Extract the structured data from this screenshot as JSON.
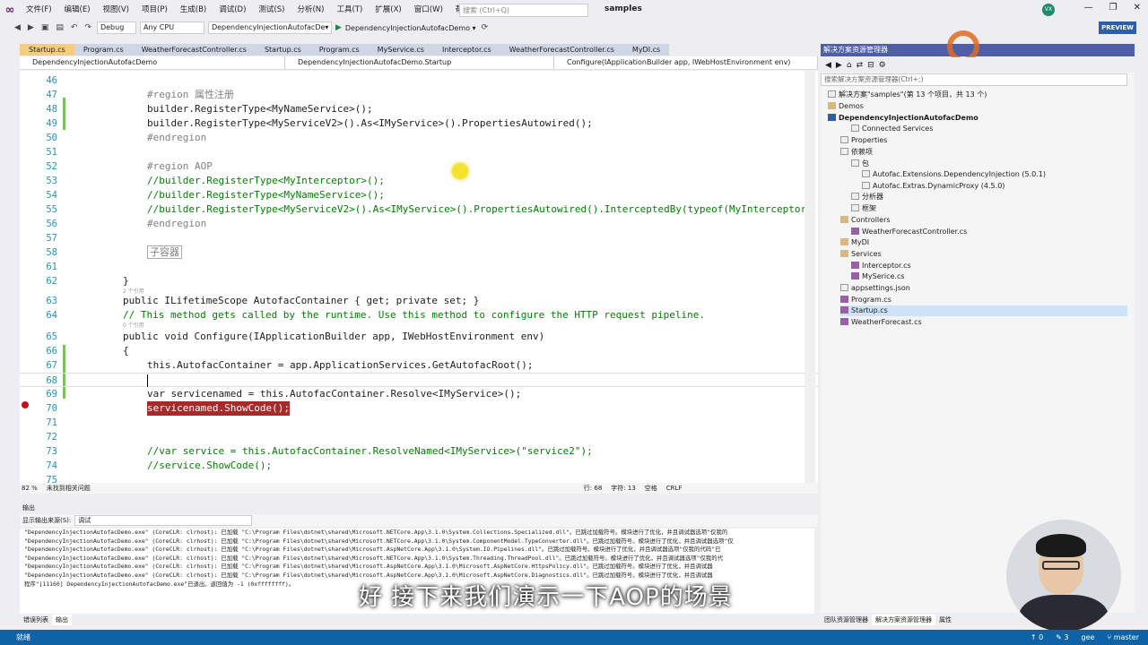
{
  "menu": {
    "items": [
      "文件(F)",
      "编辑(E)",
      "视图(V)",
      "项目(P)",
      "生成(B)",
      "调试(D)",
      "测试(S)",
      "分析(N)",
      "工具(T)",
      "扩展(X)",
      "窗口(W)",
      "帮助(H)"
    ],
    "search_placeholder": "搜索 (Ctrl+Q)",
    "solution_name": "samples",
    "avatar": "VX",
    "preview": "PREVIEW"
  },
  "toolbar": {
    "config": "Debug",
    "platform": "Any CPU",
    "project": "DependencyInjectionAutofacDe▾",
    "run_target": "DependencyInjectionAutofacDemo ▾"
  },
  "tabs": [
    "Startup.cs",
    "Program.cs",
    "WeatherForecastController.cs",
    "Startup.cs",
    "Program.cs",
    "MyService.cs",
    "Interceptor.cs",
    "WeatherForecastController.cs",
    "MyDI.cs"
  ],
  "navbar": {
    "project": "DependencyInjectionAutofacDemo",
    "class": "DependencyInjectionAutofacDemo.Startup",
    "member": "Configure(IApplicationBuilder app, IWebHostEnvironment env)"
  },
  "code": {
    "lines": [
      {
        "n": "46",
        "t": ""
      },
      {
        "n": "47",
        "t": "#region 属性注册"
      },
      {
        "n": "48",
        "t": "builder.RegisterType<MyNameService>();"
      },
      {
        "n": "49",
        "t": "builder.RegisterType<MyServiceV2>().As<IMyService>().PropertiesAutowired();"
      },
      {
        "n": "50",
        "t": "#endregion"
      },
      {
        "n": "51",
        "t": ""
      },
      {
        "n": "52",
        "t": "#region AOP"
      },
      {
        "n": "53",
        "t": "//builder.RegisterType<MyInterceptor>();"
      },
      {
        "n": "54",
        "t": "//builder.RegisterType<MyNameService>();"
      },
      {
        "n": "55",
        "t": "//builder.RegisterType<MyServiceV2>().As<IMyService>().PropertiesAutowired().InterceptedBy(typeof(MyInterceptor)"
      },
      {
        "n": "56",
        "t": "#endregion"
      },
      {
        "n": "57",
        "t": ""
      },
      {
        "n": "58",
        "t": "子容器"
      },
      {
        "n": "61",
        "t": ""
      },
      {
        "n": "62",
        "t": "}"
      },
      {
        "n": "63",
        "t": "public ILifetimeScope AutofacContainer { get; private set; }"
      },
      {
        "n": "64",
        "t": "// This method gets called by the runtime. Use this method to configure the HTTP request pipeline."
      },
      {
        "n": "65",
        "t": "public void Configure(IApplicationBuilder app, IWebHostEnvironment env)"
      },
      {
        "n": "66",
        "t": "{"
      },
      {
        "n": "67",
        "t": "this.AutofacContainer = app.ApplicationServices.GetAutofacRoot();"
      },
      {
        "n": "68",
        "t": ""
      },
      {
        "n": "69",
        "t": "var servicenamed = this.AutofacContainer.Resolve<IMyService>();"
      },
      {
        "n": "70",
        "t": "servicenamed.ShowCode();"
      },
      {
        "n": "71",
        "t": ""
      },
      {
        "n": "72",
        "t": ""
      },
      {
        "n": "73",
        "t": "//var service = this.AutofacContainer.ResolveNamed<IMyService>(\"service2\");"
      },
      {
        "n": "74",
        "t": "//service.ShowCode();"
      },
      {
        "n": "75",
        "t": ""
      }
    ],
    "refs": [
      "2 个引用",
      "0 个引用"
    ]
  },
  "editor_status": {
    "zoom": "82 %",
    "issues": "未找到相关问题",
    "line": "行: 68",
    "char": "字符: 13",
    "spaces": "空格",
    "eol": "CRLF"
  },
  "output": {
    "title": "输出",
    "source_label": "显示输出来源(S):",
    "source_value": "调试",
    "lines": [
      "\"DependencyInjectionAutofacDemo.exe\" (CoreCLR: clrhost): 已加载 \"C:\\Program Files\\dotnet\\shared\\Microsoft.NETCore.App\\3.1.0\\System.Collections.Specialized.dll\"。已跳过加载符号。模块进行了优化，并且调试器选项\"仅我的",
      "\"DependencyInjectionAutofacDemo.exe\" (CoreCLR: clrhost): 已加载 \"C:\\Program Files\\dotnet\\shared\\Microsoft.NETCore.App\\3.1.0\\System.ComponentModel.TypeConverter.dll\"。已跳过加载符号。模块进行了优化，并且调试器选项\"仅",
      "\"DependencyInjectionAutofacDemo.exe\" (CoreCLR: clrhost): 已加载 \"C:\\Program Files\\dotnet\\shared\\Microsoft.AspNetCore.App\\3.1.0\\System.IO.Pipelines.dll\"。已跳过加载符号。模块进行了优化，并且调试器选项\"仅我的代码\"已",
      "\"DependencyInjectionAutofacDemo.exe\" (CoreCLR: clrhost): 已加载 \"C:\\Program Files\\dotnet\\shared\\Microsoft.NETCore.App\\3.1.0\\System.Threading.ThreadPool.dll\"。已跳过加载符号。模块进行了优化，并且调试器选项\"仅我的代",
      "\"DependencyInjectionAutofacDemo.exe\" (CoreCLR: clrhost): 已加载 \"C:\\Program Files\\dotnet\\shared\\Microsoft.AspNetCore.App\\3.1.0\\Microsoft.AspNetCore.HttpsPolicy.dll\"。已跳过加载符号。模块进行了优化，并且调试器",
      "\"DependencyInjectionAutofacDemo.exe\" (CoreCLR: clrhost): 已加载 \"C:\\Program Files\\dotnet\\shared\\Microsoft.AspNetCore.App\\3.1.0\\Microsoft.AspNetCore.Diagnostics.dll\"。已跳过加载符号。模块进行了优化，并且调试器",
      "程序\"[11160] DependencyInjectionAutofacDemo.exe\"已退出，返回值为 -1 (0xffffffff)。"
    ],
    "subtitle": "好 接下来我们演示一下AOP的场景"
  },
  "bottom_tabs": [
    "错误列表",
    "输出"
  ],
  "solution_explorer": {
    "title": "解决方案资源管理器",
    "search_placeholder": "搜索解决方案资源管理器(Ctrl+;)",
    "nodes": [
      "解决方案\"samples\"(第 13 个项目，共 13 个)",
      "Demos",
      "DependencyInjectionAutofacDemo",
      "Connected Services",
      "Properties",
      "依赖项",
      "包",
      "Autofac.Extensions.DependencyInjection (5.0.1)",
      "Autofac.Extras.DynamicProxy (4.5.0)",
      "分析器",
      "框架",
      "Controllers",
      "WeatherForecastController.cs",
      "MyDI",
      "Services",
      "Interceptor.cs",
      "MySerice.cs",
      "appsettings.json",
      "Program.cs",
      "Startup.cs",
      "WeatherForecast.cs"
    ],
    "bottom_tabs": [
      "团队资源管理器",
      "解决方案资源管理器",
      "属性"
    ]
  },
  "status": {
    "ready": "就绪",
    "errors": "0",
    "warnings": "3",
    "user": "gee",
    "branch": "master"
  },
  "colors": {
    "accent": "#68217a",
    "status_bar": "#0e63a6",
    "active_tab": "#f5cc84",
    "keyword": "#0000ff",
    "type": "#2b91af",
    "comment": "#008000"
  }
}
